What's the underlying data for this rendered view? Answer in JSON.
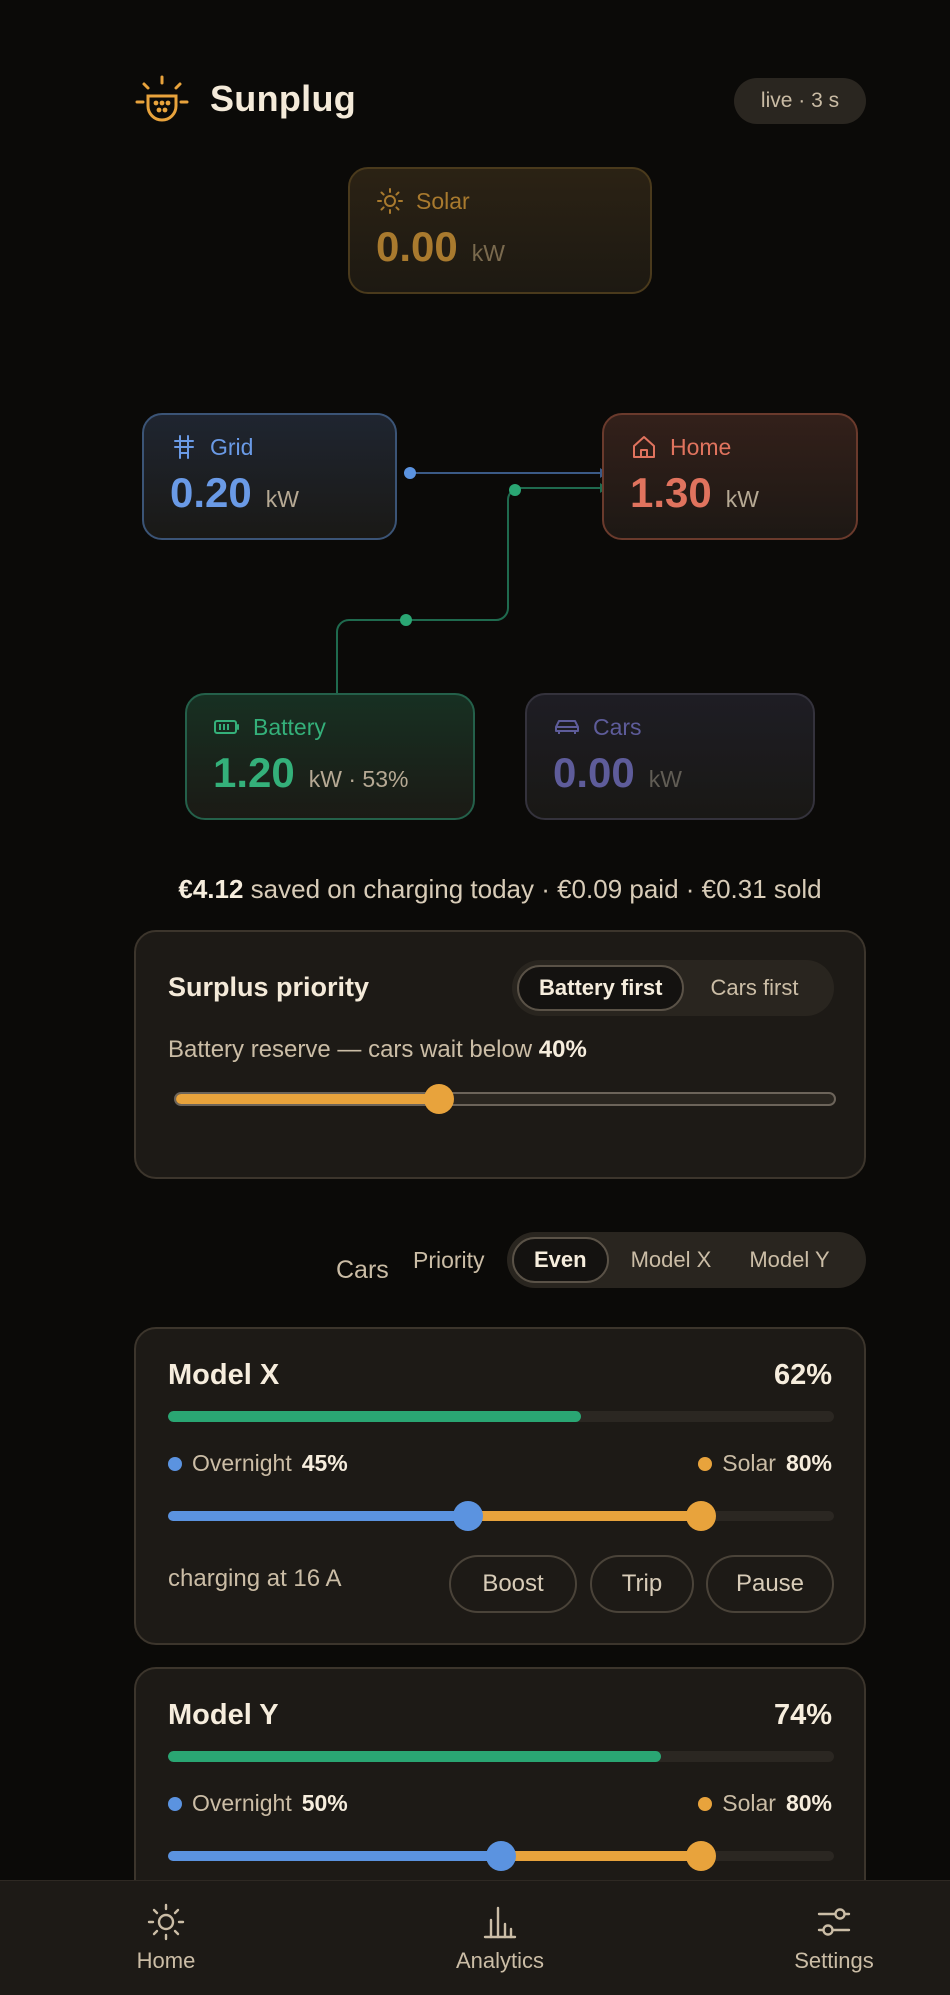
{
  "header": {
    "app_name": "Sunplug",
    "live_status": "live · 3 s"
  },
  "flow": {
    "solar": {
      "label": "Solar",
      "value": "0.00",
      "unit": "kW"
    },
    "grid": {
      "label": "Grid",
      "value": "0.20",
      "unit": "kW"
    },
    "home": {
      "label": "Home",
      "value": "1.30",
      "unit": "kW"
    },
    "battery": {
      "label": "Battery",
      "value": "1.20",
      "unit": "kW · 53%"
    },
    "cars": {
      "label": "Cars",
      "value": "0.00",
      "unit": "kW"
    }
  },
  "savings": {
    "amount": "€4.12",
    "rest": " saved on charging today · €0.09 paid · €0.31 sold"
  },
  "surplus": {
    "title": "Surplus priority",
    "options": [
      "Battery first",
      "Cars first"
    ],
    "active_option": "Battery first",
    "reserve_prefix": "Battery reserve — cars wait below ",
    "reserve_value": "40%",
    "reserve_fraction": 0.4
  },
  "cars_section": {
    "title": "Cars",
    "priority_label": "Priority",
    "priority_options": [
      "Even",
      "Model X",
      "Model Y"
    ],
    "active_priority": "Even"
  },
  "car_list": [
    {
      "name": "Model X",
      "charge": "62%",
      "charge_fraction": 0.62,
      "overnight_label": "Overnight",
      "overnight_value": "45%",
      "overnight_fraction": 0.45,
      "solar_label": "Solar",
      "solar_value": "80%",
      "solar_fraction": 0.8,
      "status": "charging at 16 A",
      "buttons": [
        "Boost",
        "Trip",
        "Pause"
      ]
    },
    {
      "name": "Model Y",
      "charge": "74%",
      "charge_fraction": 0.74,
      "overnight_label": "Overnight",
      "overnight_value": "50%",
      "overnight_fraction": 0.5,
      "solar_label": "Solar",
      "solar_value": "80%",
      "solar_fraction": 0.8
    }
  ],
  "nav": {
    "items": [
      "Home",
      "Analytics",
      "Settings"
    ]
  },
  "colors": {
    "solar": "#a97a2e",
    "grid": "#6a9ae6",
    "home": "#e0735e",
    "battery": "#34b07a",
    "cars": "#5e5c9a",
    "accent": "#e8a33c",
    "overnight": "#5b93e0"
  }
}
